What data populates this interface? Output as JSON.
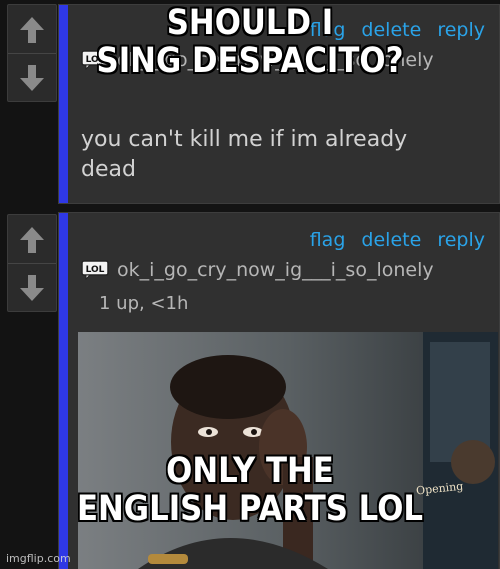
{
  "comments": [
    {
      "actions": {
        "flag": "flag",
        "delete": "delete",
        "reply": "reply"
      },
      "username": "ok_i_go_cry_now_ig___i_so_lonely",
      "username_visible": "ok_i_go_cry_now_ig___i_so_lonely",
      "text_line1": "you can't kill me if im already",
      "text_line2": "dead"
    },
    {
      "actions": {
        "flag": "flag",
        "delete": "delete",
        "reply": "reply"
      },
      "username": "ok_i_go_cry_now_ig___i_so_lonely",
      "meta": "1 up, <1h"
    }
  ],
  "badge_text": "LOL",
  "meme_text": {
    "top_line1": "SHOULD I",
    "top_line2": "SING DESPACITO?",
    "bottom_line1": "ONLY THE",
    "bottom_line2": "ENGLISH PARTS LOL"
  },
  "image_sign": "Opening",
  "watermark": "imgflip.com",
  "colors": {
    "accent_bar": "#2f38e6",
    "link": "#2aa3e8",
    "card_bg": "#303030",
    "page_bg": "#131313"
  }
}
